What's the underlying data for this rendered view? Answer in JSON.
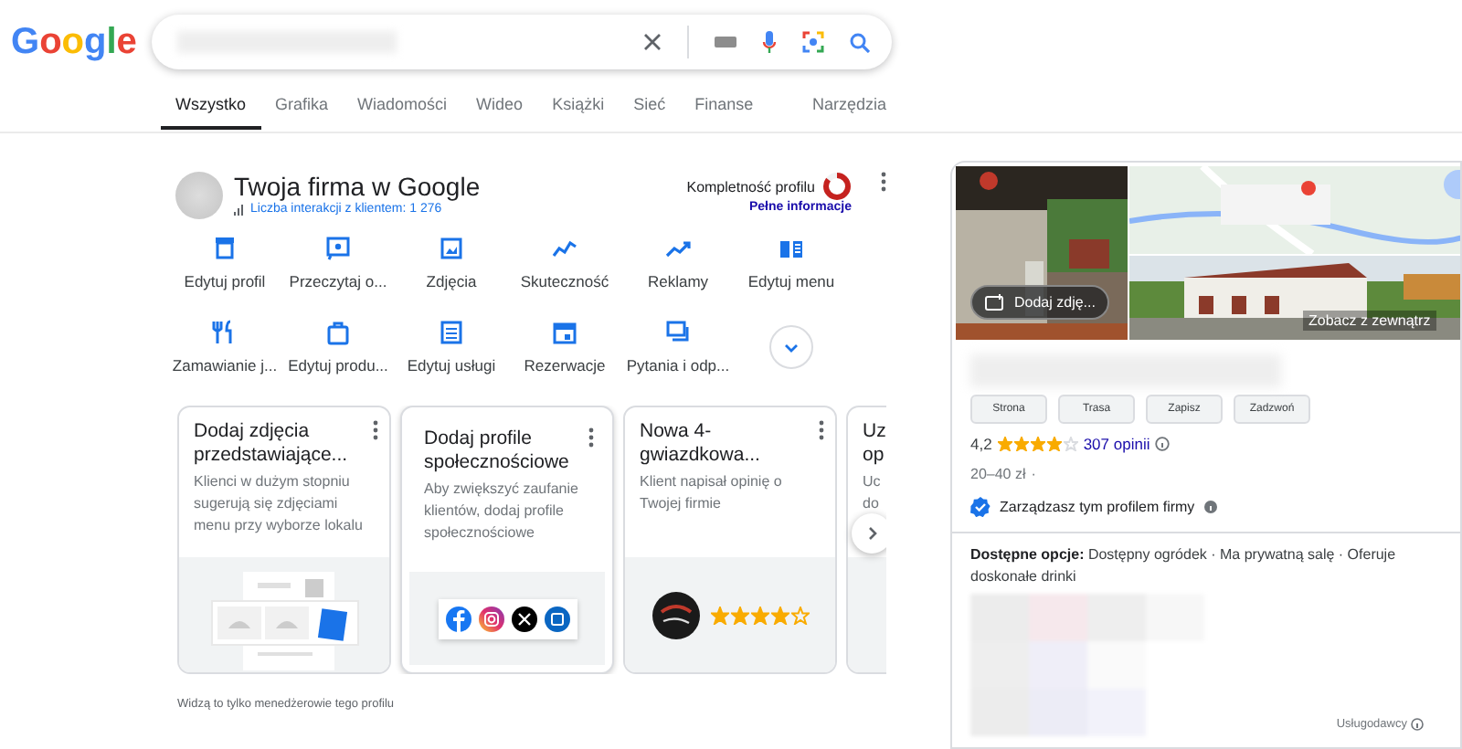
{
  "logo": "Google",
  "tabs": [
    {
      "label": "Wszystko",
      "selected": true
    },
    {
      "label": "Grafika",
      "selected": false
    },
    {
      "label": "Wiadomości",
      "selected": false
    },
    {
      "label": "Wideo",
      "selected": false
    },
    {
      "label": "Książki",
      "selected": false
    },
    {
      "label": "Sieć",
      "selected": false
    },
    {
      "label": "Finanse",
      "selected": false
    }
  ],
  "tools": "Narzędzia",
  "profile": {
    "title": "Twoja firma w Google",
    "interactions": "Liczba interakcji z klientem: 1 276",
    "completeness": {
      "label": "Kompletność profilu",
      "level": 0.85
    },
    "more_info": "Pełne informacje"
  },
  "actions": [
    "Edytuj profil",
    "Przeczytaj o...",
    "Zdjęcia",
    "Skuteczność",
    "Reklamy",
    "Edytuj menu",
    "Zamawianie j...",
    "Edytuj produ...",
    "Edytuj usługi",
    "Rezerwacje",
    "Pytania i odp..."
  ],
  "cards": [
    {
      "kind": "photos",
      "title": "Dodaj zdjęcia przedstawiające...",
      "text": "Klienci w dużym stopniu sugerują się zdjęciami menu przy wyborze lokalu"
    },
    {
      "kind": "social",
      "title": "Dodaj profile społecznościowe",
      "text": "Aby zwiększyć zaufanie klientów, dodaj profile społecznościowe"
    },
    {
      "kind": "review",
      "title": "Nowa 4-gwiazdkowa...",
      "text": "Klient napisał opinię o Twojej firmie",
      "stars": 4
    },
    {
      "kind": "partial",
      "title": "Uz op",
      "text": "Uc do"
    }
  ],
  "footer_note": "Widzą to tylko menedżerowie tego profilu",
  "panel": {
    "photo_button": "Dodaj zdję...",
    "outside": "Zobacz z zewnątrz",
    "buttons": [
      "Strona",
      "Trasa",
      "Zapisz",
      "Zadzwoń"
    ],
    "rating": "4,2",
    "stars": 4,
    "reviews": "307 opinii",
    "price": "20–40 zł",
    "price_sep": "·",
    "managed": "Zarządzasz tym profilem firmy",
    "options": "**Dostępne opcje:** Dostępny ogródek · Ma prywatną salę · Oferuje doskonałe drinki",
    "providers": "Usługodawcy"
  }
}
